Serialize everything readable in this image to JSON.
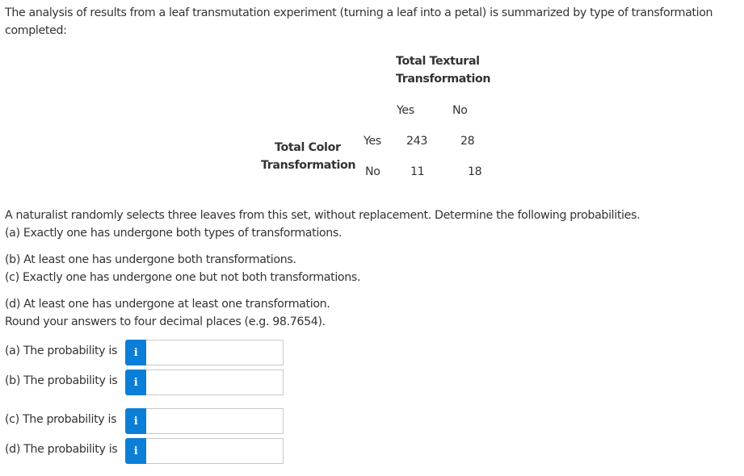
{
  "intro_text": "The analysis of results from a leaf transmutation experiment (turning a leaf into a petal) is summarized by type of transformation completed:",
  "table": {
    "column_header_line1": "Total Textural",
    "column_header_line2": "Transformation",
    "row_header_line1": "Total Color",
    "row_header_line2": "Transformation",
    "column_labels": [
      "Yes",
      "No"
    ],
    "row_labels": [
      "Yes",
      "No"
    ],
    "cells": [
      [
        "243",
        "28"
      ],
      [
        "11",
        "18"
      ]
    ]
  },
  "question": {
    "prompt": "A naturalist randomly selects three leaves from this set, without replacement. Determine the following probabilities.",
    "parts": [
      "(a) Exactly one has undergone both types of transformations.",
      "(b) At least one has undergone both transformations.",
      "(c) Exactly one has undergone one but not both transformations.",
      "(d) At least one has undergone at least one transformation."
    ],
    "rounding_note": "Round your answers to four decimal places (e.g. 98.7654)."
  },
  "answers": [
    {
      "label": "(a) The probability is",
      "info_icon": "i",
      "value": ""
    },
    {
      "label": "(b) The probability is",
      "info_icon": "i",
      "value": ""
    },
    {
      "label": "(c) The probability is",
      "info_icon": "i",
      "value": ""
    },
    {
      "label": "(d) The probability is",
      "info_icon": "i",
      "value": ""
    }
  ],
  "colors": {
    "info_button": "#0b7fd8",
    "text": "#333333"
  }
}
